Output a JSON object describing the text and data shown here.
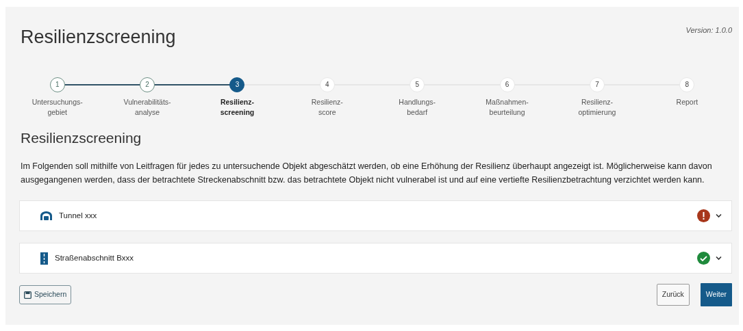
{
  "header": {
    "title": "Resilienzscreening",
    "version": "Version: 1.0.0"
  },
  "steps": [
    {
      "number": "1",
      "label": "Untersuchungs-\ngebiet",
      "completed": true,
      "selected": false
    },
    {
      "number": "2",
      "label": "Vulnerabilitäts-\nanalyse",
      "completed": true,
      "selected": false
    },
    {
      "number": "3",
      "label": "Resilienz-\nscreening",
      "completed": false,
      "selected": true
    },
    {
      "number": "4",
      "label": "Resilienz-\nscore",
      "completed": false,
      "selected": false
    },
    {
      "number": "5",
      "label": "Handlungs-\nbedarf",
      "completed": false,
      "selected": false
    },
    {
      "number": "6",
      "label": "Maßnahmen-\nbeurteilung",
      "completed": false,
      "selected": false
    },
    {
      "number": "7",
      "label": "Resilienz-\noptimierung",
      "completed": false,
      "selected": false
    },
    {
      "number": "8",
      "label": "Report",
      "completed": false,
      "selected": false
    }
  ],
  "section": {
    "title": "Resilienzscreening",
    "intro": "Im Folgenden soll mithilfe von Leitfragen für jedes zu untersuchende Objekt abgeschätzt werden, ob eine Erhöhung der Resilienz überhaupt angezeigt ist. Möglicherweise kann davon ausgegangenen werden, dass der betrachtete Streckenabschnitt bzw. das betrachtete Objekt nicht vulnerabel ist und auf eine vertiefte Resilienzbetrachtung verzichtet werden kann."
  },
  "objects": [
    {
      "kind": "tunnel",
      "name": "Tunnel xxx",
      "ok": false,
      "expanded": false
    },
    {
      "kind": "road",
      "name": "Straßenabschnitt Bxxx",
      "ok": true,
      "expanded": false
    }
  ],
  "buttons": {
    "save": "Speichern",
    "back": "Zurück",
    "next": "Weiter"
  }
}
